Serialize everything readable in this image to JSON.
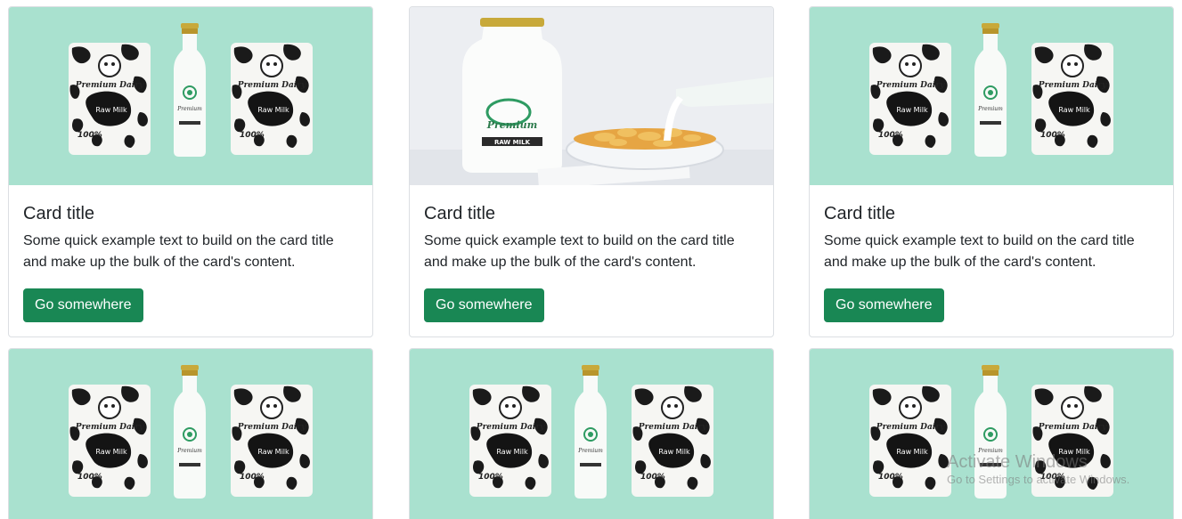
{
  "cards": [
    {
      "image": "dairy-products-flatlay",
      "title": "Card title",
      "text": "Some quick example text to build on the card title and make up the bulk of the card's content.",
      "button": "Go somewhere"
    },
    {
      "image": "milk-bottle-cereal",
      "title": "Card title",
      "text": "Some quick example text to build on the card title and make up the bulk of the card's content.",
      "button": "Go somewhere"
    },
    {
      "image": "dairy-products-flatlay",
      "title": "Card title",
      "text": "Some quick example text to build on the card title and make up the bulk of the card's content.",
      "button": "Go somewhere"
    },
    {
      "image": "dairy-products-flatlay"
    },
    {
      "image": "dairy-products-flatlay"
    },
    {
      "image": "dairy-products-flatlay"
    }
  ],
  "watermark": {
    "title": "Activate Windows",
    "subtitle": "Go to Settings to activate Windows."
  },
  "colors": {
    "button": "#198754",
    "image_mint": "#a9e1cf",
    "image_grey": "#eceef2"
  }
}
